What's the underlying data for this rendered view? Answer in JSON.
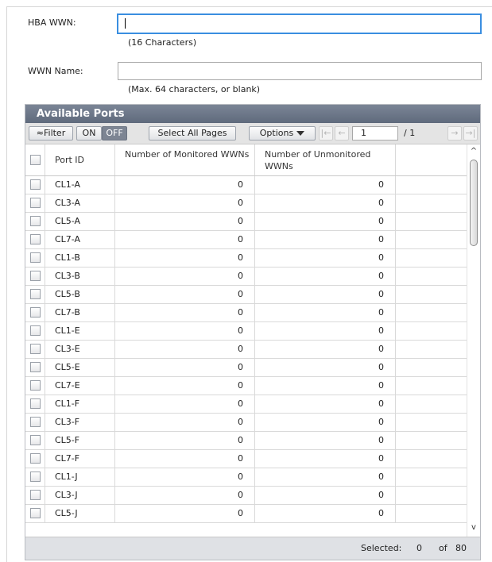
{
  "form": {
    "hba_wwn_label": "HBA WWN:",
    "hba_wwn_value": "",
    "hba_wwn_hint": "(16 Characters)",
    "wwn_name_label": "WWN Name:",
    "wwn_name_value": "",
    "wwn_name_hint": "(Max. 64 characters, or blank)"
  },
  "panel": {
    "title": "Available Ports",
    "toolbar": {
      "filter_label": "≈Filter",
      "on_label": "ON",
      "off_label": "OFF",
      "select_all_label": "Select All Pages",
      "options_label": "Options",
      "first_icon": "|←",
      "prev_icon": "←",
      "page_value": "1",
      "page_total": "/ 1",
      "next_icon": "→",
      "last_icon": "→|"
    },
    "columns": [
      "Port ID",
      "Number of Monitored WWNs",
      "Number of Unmonitored WWNs"
    ],
    "rows": [
      {
        "port": "CL1-A",
        "monitored": "0",
        "unmonitored": "0"
      },
      {
        "port": "CL3-A",
        "monitored": "0",
        "unmonitored": "0"
      },
      {
        "port": "CL5-A",
        "monitored": "0",
        "unmonitored": "0"
      },
      {
        "port": "CL7-A",
        "monitored": "0",
        "unmonitored": "0"
      },
      {
        "port": "CL1-B",
        "monitored": "0",
        "unmonitored": "0"
      },
      {
        "port": "CL3-B",
        "monitored": "0",
        "unmonitored": "0"
      },
      {
        "port": "CL5-B",
        "monitored": "0",
        "unmonitored": "0"
      },
      {
        "port": "CL7-B",
        "monitored": "0",
        "unmonitored": "0"
      },
      {
        "port": "CL1-E",
        "monitored": "0",
        "unmonitored": "0"
      },
      {
        "port": "CL3-E",
        "monitored": "0",
        "unmonitored": "0"
      },
      {
        "port": "CL5-E",
        "monitored": "0",
        "unmonitored": "0"
      },
      {
        "port": "CL7-E",
        "monitored": "0",
        "unmonitored": "0"
      },
      {
        "port": "CL1-F",
        "monitored": "0",
        "unmonitored": "0"
      },
      {
        "port": "CL3-F",
        "monitored": "0",
        "unmonitored": "0"
      },
      {
        "port": "CL5-F",
        "monitored": "0",
        "unmonitored": "0"
      },
      {
        "port": "CL7-F",
        "monitored": "0",
        "unmonitored": "0"
      },
      {
        "port": "CL1-J",
        "monitored": "0",
        "unmonitored": "0"
      },
      {
        "port": "CL3-J",
        "monitored": "0",
        "unmonitored": "0"
      },
      {
        "port": "CL5-J",
        "monitored": "0",
        "unmonitored": "0"
      }
    ],
    "footer": {
      "selected_label": "Selected:",
      "selected_count": "0",
      "of_label": "of",
      "total": "80"
    },
    "scroll_up_icon": "^",
    "scroll_down_icon": "v"
  }
}
